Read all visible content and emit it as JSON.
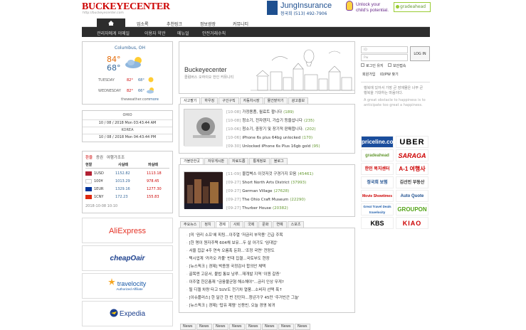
{
  "header": {
    "logo": "BUCKEYECENTER",
    "logo_url": "http://buckeyecenter.com",
    "jung_name": "JungInsurance",
    "jung_phone": "정국희 (513) 492-7906",
    "unlock_text_1": "Unlock your",
    "unlock_text_2": "child's potential.",
    "grade": "gradeahead"
  },
  "nav": {
    "items": [
      "업소록",
      "추천링크",
      "정보광장",
      "커뮤니티"
    ]
  },
  "subnav": {
    "items": [
      "관리자에게 이메일",
      "이용자 약관",
      "메뉴얼",
      "안전거래수칙"
    ]
  },
  "weather": {
    "city": "Columbus, OH",
    "hi": "84°",
    "lo": "68°",
    "rows": [
      {
        "day": "TUESDAY",
        "hi": "82°",
        "lo": "68°"
      },
      {
        "day": "WEDNESDAY",
        "hi": "82°",
        "lo": "66°"
      }
    ],
    "source": "theweather.com",
    "more": "more"
  },
  "clock": {
    "ohio_label": "OHIO",
    "ohio_time": "10 / 08 / 2018 Mon 03:43:44 AM",
    "korea_label": "KOREA",
    "korea_time": "10 / 08 / 2018 Mon 04:43:44 PM"
  },
  "fx": {
    "tabs": [
      "환율",
      "증권",
      "여행가조조"
    ],
    "head": [
      "현찰",
      "사실때",
      "파실때"
    ],
    "rows": [
      {
        "cur": "1USD",
        "buy": "1152.82",
        "sell": "1113.18"
      },
      {
        "cur": "100¥",
        "buy": "1013.29",
        "sell": "978.45"
      },
      {
        "cur": "1EUR",
        "buy": "1329.16",
        "sell": "1277.30"
      },
      {
        "cur": "1CNY",
        "buy": "172.23",
        "sell": "155.83"
      }
    ],
    "date": "2018-10-08 10:10"
  },
  "affiliates": [
    "AliExpress",
    "cheapOair",
    "travelocity",
    "Expedia"
  ],
  "affiliate_sub": "Authorized Affiliate",
  "hero": {
    "title": "Buckeyecenter",
    "subtitle": "콜럼버스 오하이오 한인 커뮤니티"
  },
  "tabs1": [
    "사고팔기",
    "하우징",
    "구인구직",
    "자동차시장",
    "물건맡아기",
    "광고홍보"
  ],
  "list1": [
    {
      "d": "[10-08]",
      "t": "가정용품, 월료트 팝니다",
      "c": "(189)"
    },
    {
      "d": "[10-08]",
      "t": "청소기, 전자렌지, 가습기 등을삽니다",
      "c": "(235)"
    },
    {
      "d": "[10-06]",
      "t": "청소기, 중장기 및 장기적 판매합니다.",
      "c": "(202)"
    },
    {
      "d": "[10-06]",
      "t": "iPhone 6s plus 64bg unlocked",
      "c": "(170)"
    },
    {
      "d": "[09-30]",
      "t": "Unlocked iPhone 6s Plus 16gb gold",
      "c": "(95)"
    }
  ],
  "tabs2": [
    "가볼만한곳",
    "자유게시판",
    "자료드롭",
    "통계정보",
    "블로그"
  ],
  "list2": [
    {
      "d": "[11-09]",
      "t": "물컵벽스 이것저것 구경가지 모음",
      "c": "(45461)"
    },
    {
      "d": "[09-27]",
      "t": "Short North Arts District",
      "c": "(37993)"
    },
    {
      "d": "[09-27]",
      "t": "German Village",
      "c": "(27628)"
    },
    {
      "d": "[09-27]",
      "t": "The Ohio Craft Museum",
      "c": "(22290)"
    },
    {
      "d": "[09-27]",
      "t": "Thurber House",
      "c": "(20382)"
    }
  ],
  "tabs3": [
    "주요뉴스",
    "정치",
    "경제",
    "사회",
    "국제",
    "문화",
    "연예",
    "스포츠"
  ],
  "news": [
    "[미 '권리 소프'에 피팅...이주열 '저금리 부작용' 긴급 주목",
    "[한 명이 원자주택 604채 보유...두 살 아기도 '임대업'",
    "서울 집값 4주 연속 오름폭 둔화...'조정 국면' 전망도",
    "택시업계 '카카오 카풀' 반대 집결...국토부도 현장",
    "[뉴스픽크 | 경제] 박종원 국정감사 합의안 체택",
    "골목엔 고문서, 불법 통보 남루...재개발 지역 '이원 갈증'",
    "이주열 한은총재 \"금융불균형 해소해야\"...금리 인상 무게?",
    "될 디젤 차량 타고 SUV도 전기차 열풍...소비자 선택 폭↑",
    "[이슈플러스] 한 달간 한 번 진단자...청년가구 45만 '주거빈곤 그늘'",
    "[뉴스픽크 | 경제] '탑유 제렴' 신동빈, 오늘 경영 복귀"
  ],
  "bottom_tabs": [
    "News",
    "News",
    "News",
    "News",
    "News",
    "News",
    "News",
    "News"
  ],
  "login": {
    "id_placeholder": "ID",
    "pw_placeholder": "Pw",
    "btn": "LOG IN",
    "remember": "로그인 유지",
    "ssl": "보안접속",
    "join": "회원가입",
    "find": "ID/PW 찾기"
  },
  "quote": {
    "ko": "행복에 있어서 가장 큰 장애물은 너무 큰 행복을 기대하는 마음이다.",
    "en": "A great obstacle to happiness is to anticipate too great a happiness."
  },
  "sponsors": [
    "priceline.com",
    "UBER",
    "gradeahead",
    "SARAGA",
    "한인 복지센터",
    "A-1 여행사",
    "정국희 보험",
    "김선민 부동산",
    "Movie Showtimes",
    "Auto Quote",
    "Great Travel Deals travelocity",
    "GROUPON",
    "KBS",
    "KIAO"
  ],
  "colors": {
    "red": "#cc0000",
    "dark": "#2d2d2d",
    "blue": "#1e4f8f",
    "green": "#669933"
  }
}
